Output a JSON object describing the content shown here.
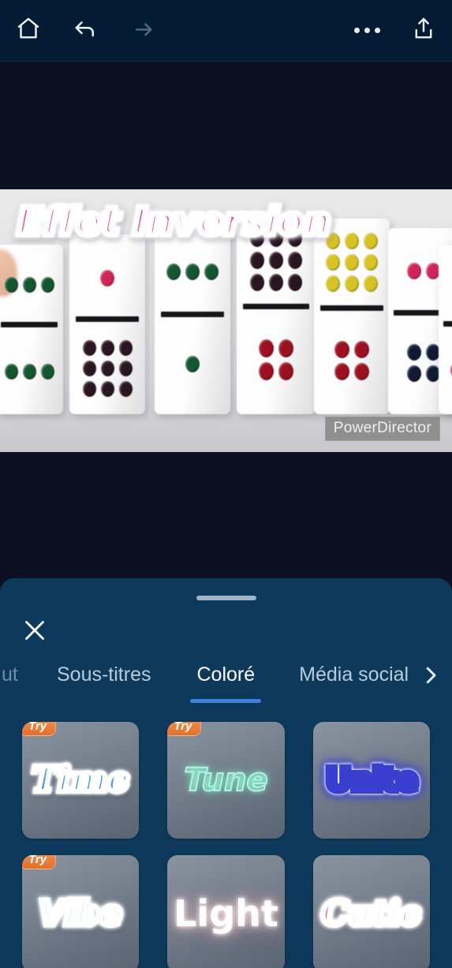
{
  "toolbar": {
    "home_label": "home-icon",
    "undo_label": "undo-icon",
    "redo_label": "redo-icon",
    "more_label": "more-options-icon",
    "export_label": "export-icon"
  },
  "preview": {
    "overlay_title": "Effet Inversion",
    "watermark": "PowerDirector",
    "title_gradient_top": "#e255c9",
    "title_gradient_bottom": "#f4a056"
  },
  "sheet": {
    "close_label": "close-icon",
    "next_label": "chevron-right-icon",
    "accent_color": "#3b82d8",
    "background_color": "#0d3a5c",
    "tabs": [
      {
        "label": "ut",
        "active": false,
        "partial": true
      },
      {
        "label": "Sous-titres",
        "active": false,
        "partial": false
      },
      {
        "label": "Coloré",
        "active": true,
        "partial": false
      },
      {
        "label": "Média social",
        "active": false,
        "partial": false
      }
    ],
    "badge_text": "Try",
    "badge_color": "#e8803c",
    "presets": [
      {
        "name": "Time",
        "badge": true,
        "style": "s-time"
      },
      {
        "name": "Tune",
        "badge": true,
        "style": "s-tune"
      },
      {
        "name": "Unite",
        "badge": false,
        "style": "s-unite"
      },
      {
        "name": "Vibe",
        "badge": true,
        "style": "s-vibe"
      },
      {
        "name": "Light",
        "badge": false,
        "style": "s-light"
      },
      {
        "name": "Cutie",
        "badge": false,
        "style": "s-cutie"
      }
    ]
  }
}
